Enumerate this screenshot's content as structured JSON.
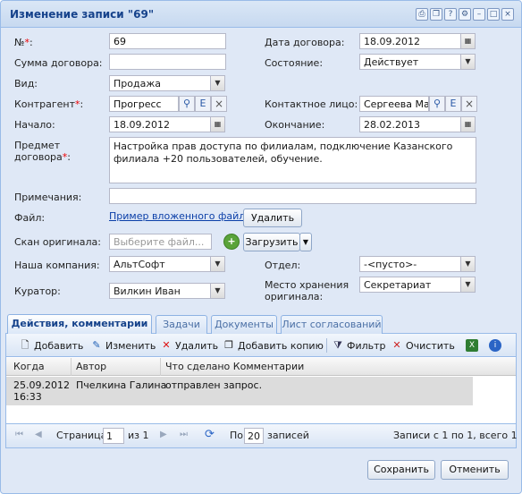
{
  "window": {
    "title": "Изменение записи \"69\"",
    "tools": [
      "print-icon",
      "copy-icon",
      "help-icon",
      "gear-icon",
      "minimize-icon",
      "maximize-icon",
      "close-icon"
    ]
  },
  "form": {
    "number": {
      "label": "№",
      "req": "*",
      "colon": ":",
      "value": "69"
    },
    "contract_date": {
      "label": "Дата договора:",
      "value": "18.09.2012"
    },
    "amount": {
      "label": "Сумма договора:",
      "value": ""
    },
    "state": {
      "label": "Состояние:",
      "value": "Действует"
    },
    "kind": {
      "label": "Вид:",
      "value": "Продажа"
    },
    "counterparty": {
      "label": "Контрагент",
      "req": "*",
      "colon": ":",
      "value": "Прогресс"
    },
    "contact": {
      "label": "Контактное лицо:",
      "value": "Сергеева Мар"
    },
    "start": {
      "label": "Начало:",
      "value": "18.09.2012"
    },
    "end": {
      "label": "Окончание:",
      "value": "28.02.2013"
    },
    "subject": {
      "label1": "Предмет",
      "label2": "договора",
      "req": "*",
      "colon": ":",
      "value": "Настройка прав доступа по филиалам, подключение Казанского филиала +20 пользователей, обучение."
    },
    "notes": {
      "label": "Примечания:",
      "value": ""
    },
    "file": {
      "label": "Файл:",
      "link": "Пример вложенного файл~.do",
      "delete": "Удалить"
    },
    "scan": {
      "label": "Скан оригинала:",
      "placeholder": "Выберите файл...",
      "upload": "Загрузить"
    },
    "company": {
      "label": "Наша компания:",
      "value": "АльтСофт"
    },
    "department": {
      "label": "Отдел:",
      "value": "-<пусто>-"
    },
    "curator": {
      "label": "Куратор:",
      "value": "Вилкин Иван"
    },
    "storage": {
      "label1": "Место хранения",
      "label2": "оригинала:",
      "value": "Секретариат"
    }
  },
  "tabs": [
    "Действия, комментарии",
    "Задачи",
    "Документы",
    "Лист согласований"
  ],
  "toolbar": {
    "add": "Добавить",
    "edit": "Изменить",
    "delete": "Удалить",
    "add_copy": "Добавить копию",
    "filter": "Фильтр",
    "clear": "Очистить"
  },
  "grid": {
    "columns": [
      "Когда",
      "Автор",
      "Что сделано Комментарии"
    ],
    "rows": [
      {
        "when": "25.09.2012",
        "when2": "16:33",
        "author": "Пчелкина Галина",
        "what": "отправлен запрос."
      }
    ]
  },
  "pager": {
    "page_label": "Страница",
    "page": "1",
    "of": "из 1",
    "per_label": "По",
    "per": "20",
    "per_suffix": "записей",
    "info": "Записи с 1 по 1, всего 1"
  },
  "buttons": {
    "save": "Сохранить",
    "cancel": "Отменить"
  }
}
